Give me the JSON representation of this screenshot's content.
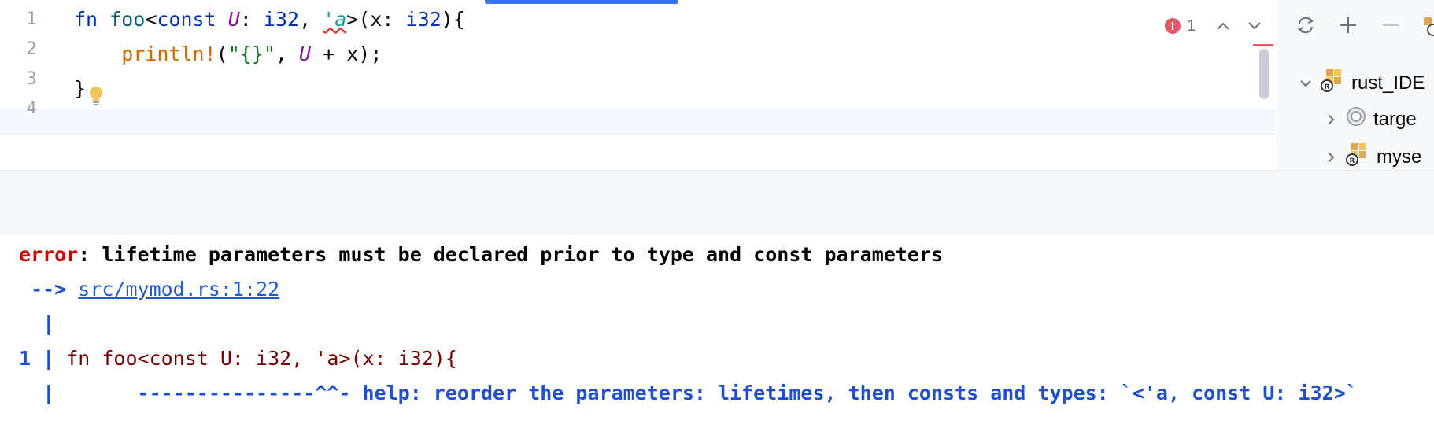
{
  "editor": {
    "line_numbers": [
      "1",
      "2",
      "3",
      "4"
    ],
    "line1": {
      "kw_fn": "fn",
      "fn_name": "foo",
      "open": "<",
      "kw_const": "const",
      "type_param": "U",
      "colon1": ": ",
      "type1": "i32",
      "comma": ", ",
      "lifetime": "'a",
      "mid": ">(x: ",
      "type2": "i32",
      "close": "){"
    },
    "line2": {
      "indent": "    ",
      "macro": "println!",
      "open": "(",
      "str": "\"{}\"",
      "comma": ", ",
      "type_param": "U",
      "rest": " + x);"
    },
    "line3": "}",
    "bulb_icon": "lightbulb-icon",
    "inspection": {
      "error_count": "1",
      "error_icon": "error-icon",
      "prev_icon": "chevron-up-icon",
      "next_icon": "chevron-down-icon"
    }
  },
  "project_tree": {
    "toolbar_icons": [
      "sync-icon",
      "add-icon",
      "remove-icon"
    ],
    "items": [
      {
        "label": "rust_IDE",
        "icon": "rust-module-icon",
        "expanded": true
      },
      {
        "label": "targe",
        "icon": "target-folder-icon",
        "expanded": false
      },
      {
        "label": "myse",
        "icon": "rust-module-icon",
        "expanded": false
      }
    ]
  },
  "console": {
    "error_label": "error",
    "error_message": ": lifetime parameters must be declared prior to type and const parameters",
    "arrow": " --> ",
    "location_link": "src/mymod.rs:1:22",
    "pipe": "  |",
    "line_no": "1 |",
    "source": " fn foo<const U: i32, 'a>(x: i32){",
    "help_pipe": "  |",
    "help_line": "       ---------------^^- help: reorder the parameters: lifetimes, then consts and types: `<'a, const U: i32>`"
  },
  "colors": {
    "accent": "#3574f0",
    "error": "#e55765",
    "keyword": "#0033b3",
    "macro": "#d16b00",
    "string": "#067d17",
    "type_param": "#871094"
  }
}
